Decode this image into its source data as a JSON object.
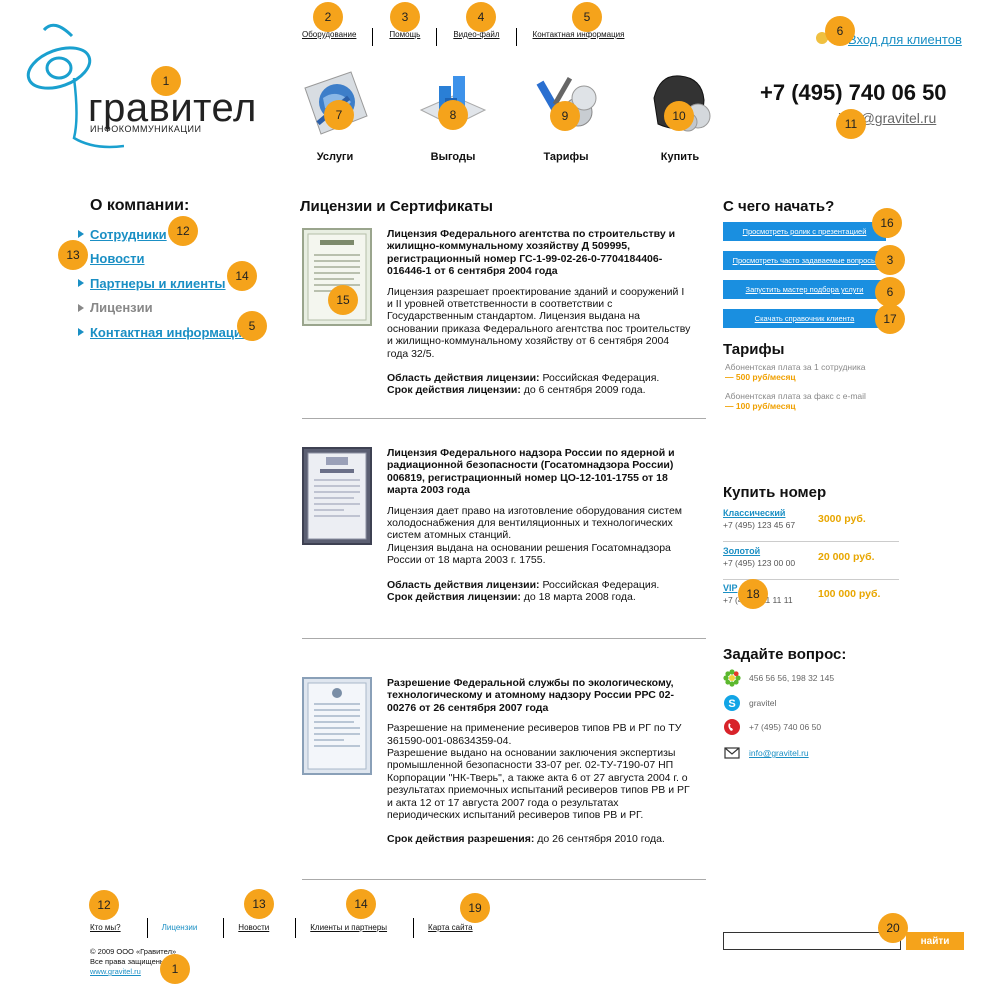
{
  "topnav": [
    {
      "label": "Оборудование"
    },
    {
      "label": "Помощь"
    },
    {
      "label": "Видео-файл"
    },
    {
      "label": "Контактная информация"
    }
  ],
  "header": {
    "logo_text": "гравител",
    "logo_sub": "ИНФОКОММУНИКАЦИИ",
    "clients_link": "Вход для клиентов",
    "phone": "+7 (495) 740 06 50",
    "email": "info@gravitel.ru"
  },
  "services": [
    {
      "label": "Услуги"
    },
    {
      "label": "Выгоды"
    },
    {
      "label": "Тарифы"
    },
    {
      "label": "Купить"
    }
  ],
  "left": {
    "title": "О компании:",
    "items": [
      {
        "label": "Сотрудники"
      },
      {
        "label": "Новости"
      },
      {
        "label": "Партнеры и клиенты"
      },
      {
        "label": "Лицензии"
      },
      {
        "label": "Контактная информация"
      }
    ]
  },
  "main": {
    "title": "Лицензии и Сертификаты",
    "licenses": [
      {
        "heading": "Лицензия Федерального агентства по строительству и жилищно-коммунальному хозяйству Д 509995, регистрационный номер ГС-1-99-02-26-0-7704184406-016446-1 от 6 сентября 2004 года",
        "text1": "Лицензия разрешает проектирование зданий и сооружений I и II уровней ответственности в соответствии с Государственным стандартом. Лицензия выдана на основании приказа Федерального агентства пос троительству и жилищно-коммунальному хозяйству от 6 сентября 2004 года 32/5.",
        "area_label": "Область действия лицензии:",
        "area_value": " Российская Федерация.",
        "term_label": "Срок действия лицензии:",
        "term_value": " до 6 сентября 2009 года."
      },
      {
        "heading": "Лицензия Федерального надзора России по ядерной и радиационной безопасности (Госатомнадзора России) 006819, регистрационный номер ЦО-12-101-1755 от 18 марта 2003 года",
        "text1": "Лицензия дает право на изготовление оборудования систем холодоснабжения для вентиляционных и технологических систем атомных станций.",
        "text2": "Лицензия выдана на основании решения Госатомнадзора России от 18 марта 2003 г. 1755.",
        "area_label": "Область действия лицензии:",
        "area_value": " Российская Федерация.",
        "term_label": "Срок действия лицензии:",
        "term_value": " до 18 марта 2008 года."
      },
      {
        "heading": "Разрешение Федеральной службы по экологическому, технологическому и атомному надзору России РРС 02-00276 от 26 сентября 2007 года",
        "text1": "Разрешение на применение ресиверов типов РВ и РГ по ТУ 361590-001-08634359-04.",
        "text2": "Разрешение выдано на основании заключения экспертизы промышленной безопасности 33-07 рег. 02-ТУ-7190-07 НП Корпорации \"НК-Тверь\", а также акта 6 от 27 августа 2004 г. о результатах приемочных испытаний ресиверов типов РВ и РГ и акта 12 от 17 августа 2007 года о результатах периодических испытаний ресиверов типов РВ и РГ.",
        "term_label": "Срок действия разрешения:",
        "term_value": " до 26 сентября 2010 года."
      }
    ]
  },
  "right": {
    "start_title": "С чего начать?",
    "buttons": [
      {
        "label": "Просмотреть ролик с презентацией"
      },
      {
        "label": "Просмотреть часто задаваемые вопросы"
      },
      {
        "label": "Запустить мастер подбора услуги"
      },
      {
        "label": "Скачать справочник клиента"
      }
    ],
    "tariffs_title": "Тарифы",
    "tariffs": [
      {
        "line": "Абонентская плата за 1 сотрудника",
        "price": "— 500 руб/месяц"
      },
      {
        "line": "Абонентская плата за факс с e-mail",
        "price": "— 100 руб/месяц"
      }
    ],
    "buy_title": "Купить номер",
    "numbers": [
      {
        "name": "Классический",
        "number": "+7 (495) 123 45 67",
        "price": "3000 руб."
      },
      {
        "name": "Золотой",
        "number": "+7 (495) 123 00 00",
        "price": "20 000 руб."
      },
      {
        "name": "VIP",
        "number": "+7 (495) 111 11 11",
        "price": "100 000 руб."
      }
    ],
    "ask_title": "Задайте вопрос:",
    "contacts": [
      {
        "icon": "icq-icon",
        "value": "456 56 56, 198 32 145"
      },
      {
        "icon": "skype-icon",
        "value": "gravitel"
      },
      {
        "icon": "phone-icon",
        "value": "+7 (495) 740 06 50"
      },
      {
        "icon": "mail-icon",
        "value": "info@gravitel.ru"
      }
    ]
  },
  "footer": {
    "nav": [
      {
        "label": "Кто мы?"
      },
      {
        "label": "Лицензии"
      },
      {
        "label": "Новости"
      },
      {
        "label": "Клиенты и партнеры"
      },
      {
        "label": "Карта сайта"
      }
    ],
    "copyright": "© 2009 ООО «Гравител»",
    "rights": "Все права защищены",
    "site": "www.gravitel.ru",
    "search_button": "найти"
  },
  "badges": [
    "1",
    "2",
    "3",
    "4",
    "5",
    "6",
    "7",
    "8",
    "9",
    "10",
    "11",
    "12",
    "13",
    "14",
    "15",
    "16",
    "3",
    "6",
    "17",
    "18",
    "12",
    "13",
    "14",
    "19",
    "20",
    "1",
    "5"
  ],
  "colors": {
    "accent": "#1a8fc4",
    "badge": "#f5a31b",
    "button_blue": "#1a8fe0",
    "price": "#e8a600"
  }
}
